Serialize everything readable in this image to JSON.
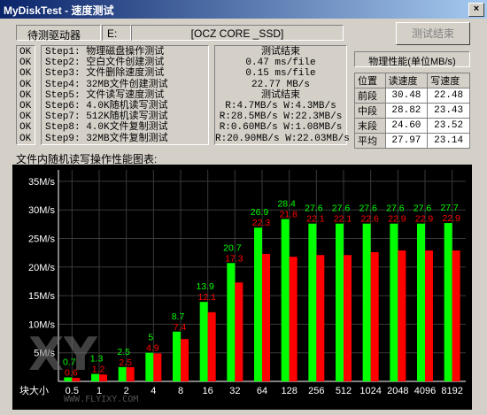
{
  "window": {
    "title": "MyDiskTest - 速度测试",
    "close_glyph": "×"
  },
  "drive": {
    "label": "待测驱动器",
    "letter": "E:",
    "model": "[OCZ CORE _SSD]"
  },
  "finish_button": "测试结束",
  "steps": [
    {
      "status": "OK",
      "name": "Step1: 物理磁盘操作测试"
    },
    {
      "status": "OK",
      "name": "Step2: 空白文件创建测试"
    },
    {
      "status": "OK",
      "name": "Step3: 文件删除速度测试"
    },
    {
      "status": "OK",
      "name": "Step4: 32MB文件创建测试"
    },
    {
      "status": "OK",
      "name": "Step5: 文件读写速度测试"
    },
    {
      "status": "OK",
      "name": "Step6: 4.0K随机读写测试"
    },
    {
      "status": "OK",
      "name": "Step7: 512K随机读写测试"
    },
    {
      "status": "OK",
      "name": "Step8: 4.0K文件复制测试"
    },
    {
      "status": "OK",
      "name": "Step9: 32MB文件复制测试"
    }
  ],
  "results": [
    "测试结束",
    "0.47 ms/file",
    "0.15 ms/file",
    "22.77 MB/s",
    "测试结束",
    "R:4.7MB/s W:4.3MB/s",
    "R:28.5MB/s W:22.3MB/s",
    "R:0.60MB/s W:1.08MB/s",
    "R:20.90MB/s W:22.03MB/s"
  ],
  "perf": {
    "title": "物理性能(单位MB/s)",
    "headers": [
      "位置",
      "读速度",
      "写速度"
    ],
    "rows": [
      {
        "pos": "前段",
        "read": "30.48",
        "write": "22.48"
      },
      {
        "pos": "中段",
        "read": "28.82",
        "write": "23.43"
      },
      {
        "pos": "末段",
        "read": "24.60",
        "write": "23.52"
      },
      {
        "pos": "平均",
        "read": "27.97",
        "write": "23.14"
      }
    ]
  },
  "chart_title": "文件内随机读写操作性能图表:",
  "colors": {
    "read": "#00ff00",
    "write": "#ff0000",
    "background": "#000000",
    "grid": "#3a3a3a"
  },
  "chart_data": {
    "type": "bar",
    "title": "文件内随机读写操作性能图表:",
    "xlabel": "",
    "ylabel": "",
    "x_axis_label": "块大小",
    "y_ticks": [
      "5M/s",
      "10M/s",
      "15M/s",
      "20M/s",
      "25M/s",
      "30M/s",
      "35M/s"
    ],
    "ylim": [
      0,
      37
    ],
    "categories": [
      "0.5",
      "1",
      "2",
      "4",
      "8",
      "16",
      "32",
      "64",
      "128",
      "256",
      "512",
      "1024",
      "2048",
      "4096",
      "8192"
    ],
    "series": [
      {
        "values": [
          0.7,
          1.3,
          2.5,
          5.0,
          8.7,
          13.9,
          20.7,
          26.9,
          28.4,
          27.6,
          27.6,
          27.6,
          27.6,
          27.6,
          27.7
        ]
      },
      {
        "values": [
          0.6,
          1.2,
          2.5,
          4.9,
          7.4,
          12.1,
          17.3,
          22.3,
          21.8,
          22.1,
          22.1,
          22.6,
          22.9,
          22.9,
          22.9
        ]
      }
    ],
    "grid": true
  },
  "watermark": {
    "logo": "XY",
    "url": "WWW.FLYIXY.COM"
  }
}
